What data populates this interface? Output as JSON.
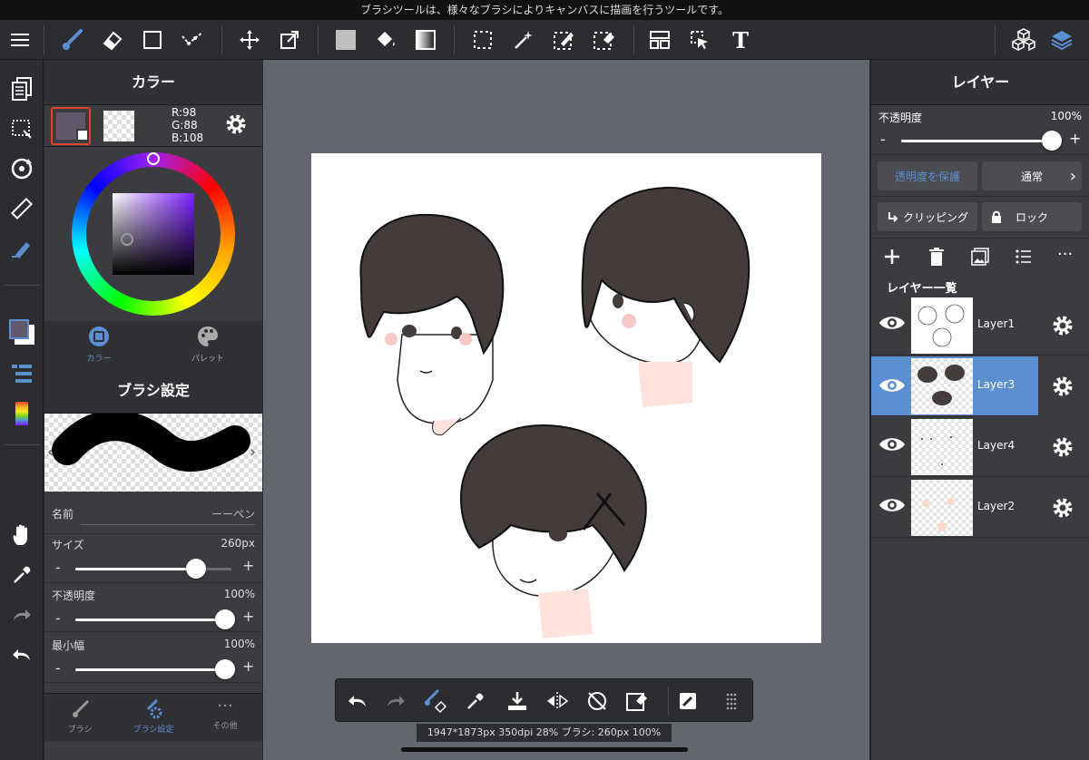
{
  "status_message": "ブラシツールは、様々なブラシによりキャンバスに描画を行うツールです。",
  "toolbar": {
    "icons": [
      "menu-icon",
      "brush-icon",
      "eraser-icon",
      "shape-icon",
      "dot-line-icon",
      "move-icon",
      "transform-icon",
      "fill-color-icon",
      "bucket-icon",
      "gradient-icon",
      "select-rect-icon",
      "magic-wand-icon",
      "select-pen-icon",
      "select-eraser-icon",
      "panel-layout-icon",
      "select-move-icon",
      "text-icon",
      "material-icon",
      "layers-icon"
    ]
  },
  "color_panel": {
    "title": "カラー",
    "rgb": {
      "r": "R:98",
      "g": "G:88",
      "b": "B:108"
    },
    "current_color": "#62586c",
    "tabs": [
      {
        "label": "カラー",
        "active": true
      },
      {
        "label": "パレット",
        "active": false
      }
    ]
  },
  "brush_panel": {
    "title": "ブラシ設定",
    "name_label": "名前",
    "name_value": "ーーペン",
    "size": {
      "label": "サイズ",
      "value": "260px",
      "level": 0.73
    },
    "opacity": {
      "label": "不透明度",
      "value": "100%",
      "level": 1.0
    },
    "min_width": {
      "label": "最小幅",
      "value": "100%",
      "level": 1.0
    },
    "minus": "-",
    "plus": "+",
    "tabs": [
      {
        "label": "ブラシ"
      },
      {
        "label": "ブラシ設定"
      },
      {
        "label": "その他"
      }
    ]
  },
  "layer_panel": {
    "title": "レイヤー",
    "opacity_label": "不透明度",
    "opacity_value": "100%",
    "protect_alpha": "透明度を保護",
    "blend_mode": "通常",
    "clipping": "クリッピング",
    "lock": "ロック",
    "list_title": "レイヤー一覧",
    "layers": [
      {
        "name": "Layer1",
        "selected": false
      },
      {
        "name": "Layer3",
        "selected": true
      },
      {
        "name": "Layer4",
        "selected": false
      },
      {
        "name": "Layer2",
        "selected": false
      }
    ]
  },
  "info_bar": "1947*1873px 350dpi 28% ブラシ: 260px 100%",
  "colors": {
    "accent": "#5b8fd1",
    "panel": "#3a3c40",
    "bg": "#2b2d31",
    "canvas_bg": "#63666c",
    "hair": "#433c3b"
  }
}
